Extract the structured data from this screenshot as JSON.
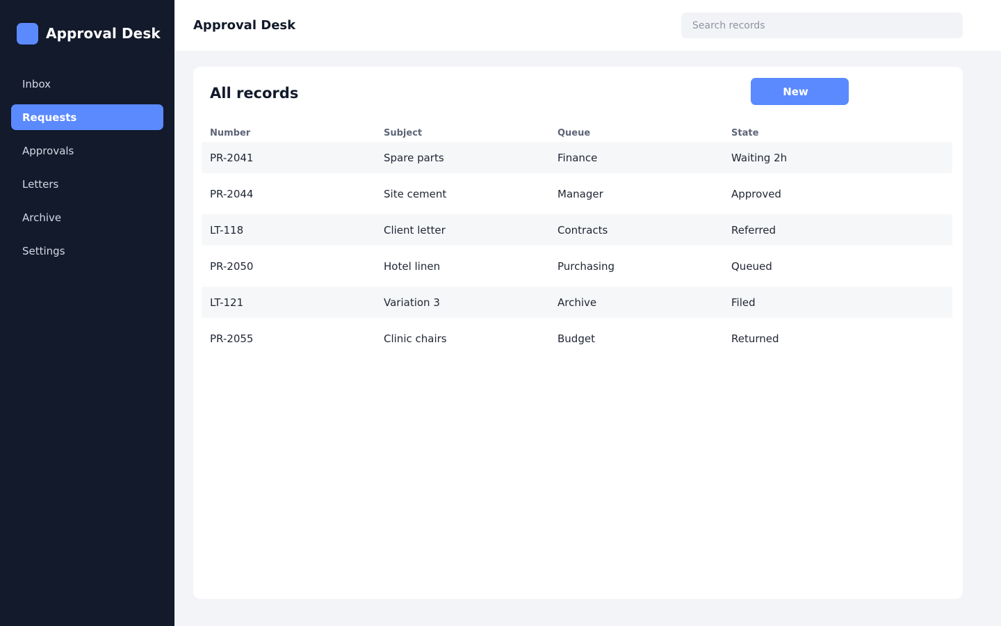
{
  "colors": {
    "sidebar_bg": "#121a2b",
    "accent": "#5b8aff",
    "page_bg": "#f3f4f7"
  },
  "sidebar": {
    "brand": {
      "logo_icon": "rounded-square-logo-icon",
      "name": "Approval Desk"
    },
    "items": [
      {
        "label": "Inbox",
        "active": false
      },
      {
        "label": "Requests",
        "active": true
      },
      {
        "label": "Approvals",
        "active": false
      },
      {
        "label": "Letters",
        "active": false
      },
      {
        "label": "Archive",
        "active": false
      },
      {
        "label": "Settings",
        "active": false
      }
    ]
  },
  "header": {
    "title": "Approval Desk",
    "search": {
      "placeholder": "Search records",
      "value": ""
    }
  },
  "records": {
    "title": "All records",
    "new_label": "New",
    "columns": [
      "Number",
      "Subject",
      "Queue",
      "State"
    ],
    "rows": [
      [
        "PR-2041",
        "Spare parts",
        "Finance",
        "Waiting 2h"
      ],
      [
        "PR-2044",
        "Site cement",
        "Manager",
        "Approved"
      ],
      [
        "LT-118",
        "Client letter",
        "Contracts",
        "Referred"
      ],
      [
        "PR-2050",
        "Hotel linen",
        "Purchasing",
        "Queued"
      ],
      [
        "LT-121",
        "Variation 3",
        "Archive",
        "Filed"
      ],
      [
        "PR-2055",
        "Clinic chairs",
        "Budget",
        "Returned"
      ]
    ]
  }
}
